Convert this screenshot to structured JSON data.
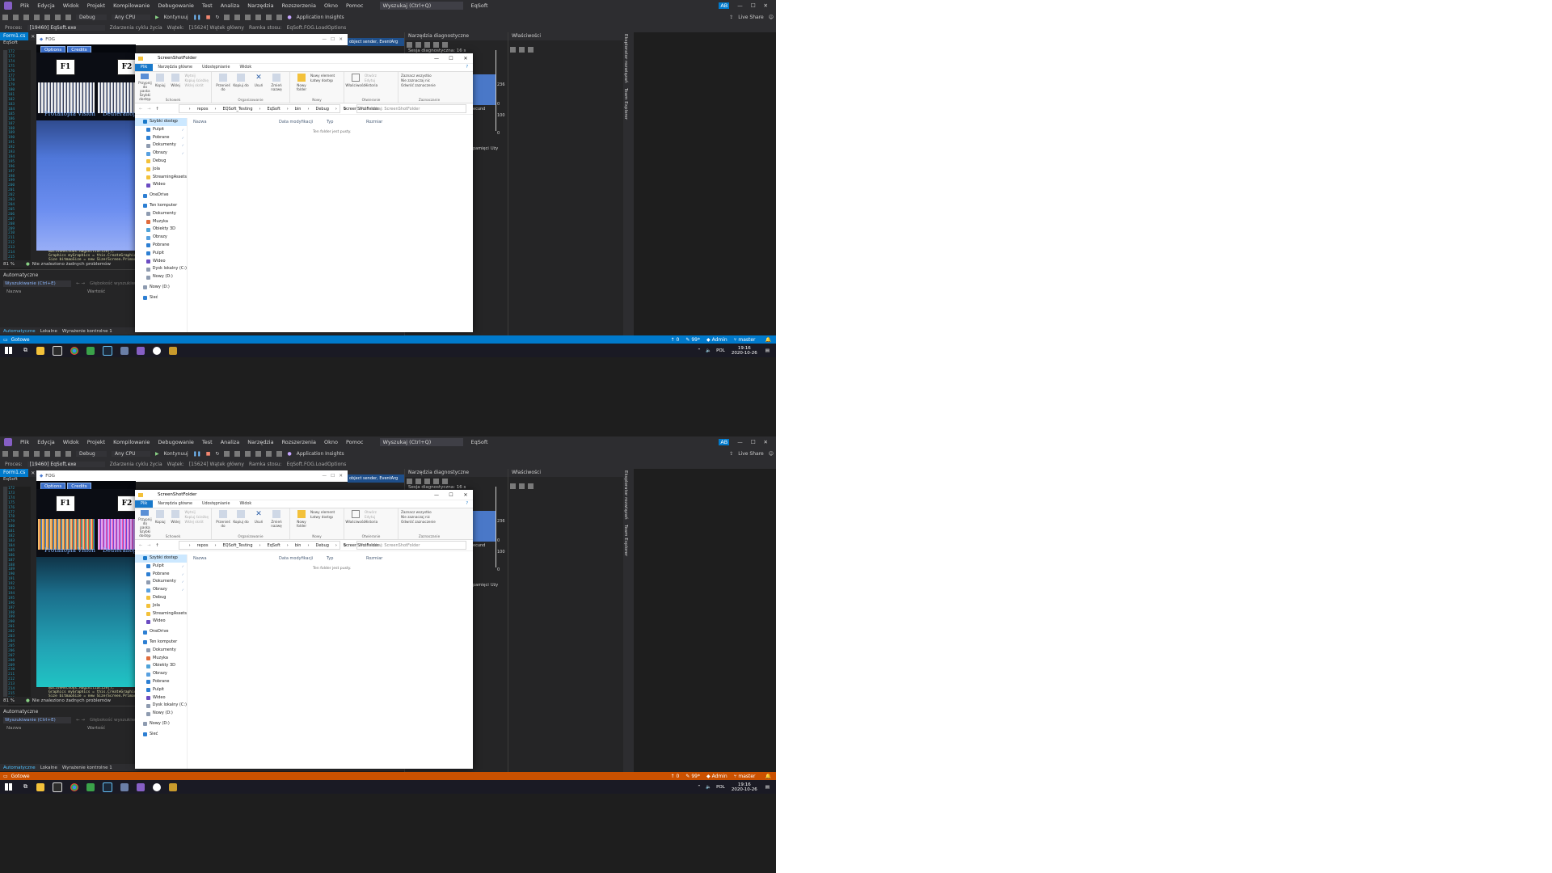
{
  "vs": {
    "menu": [
      "Plik",
      "Edycja",
      "Widok",
      "Projekt",
      "Kompilowanie",
      "Debugowanie",
      "Test",
      "Analiza",
      "Narzędzia",
      "Rozszerzenia",
      "Okno",
      "Pomoc"
    ],
    "search_placeholder": "Wyszukaj (Ctrl+Q)",
    "solution_name": "EqSoft",
    "user_initials": "AB",
    "toolbar": {
      "config": "Debug",
      "platform": "Any CPU",
      "continue_label": "Kontynuuj",
      "app_insights": "Application Insights",
      "live_share": "Live Share"
    },
    "process_bar": {
      "process_label": "Proces:",
      "process_value": "[19460] EqSoft.exe",
      "lifecycle": "Zdarzenia cyklu życia",
      "thread_label": "Wątek:",
      "thread_value": "[15624] Wątek główny",
      "stack_label": "Ramka stosu:",
      "stack_value": "EqSoft.FOG.LoadOptions"
    },
    "editor_tab": "Form1.cs",
    "editor_tab2": "EqSoft",
    "line_numbers": [
      "172",
      "173",
      "174",
      "175",
      "176",
      "177",
      "178",
      "179",
      "180",
      "181",
      "182",
      "183",
      "184",
      "185",
      "186",
      "187",
      "188",
      "189",
      "190",
      "191",
      "192",
      "193",
      "194",
      "195",
      "196",
      "197",
      "198",
      "199",
      "200",
      "201",
      "202",
      "203",
      "204",
      "205",
      "206",
      "207",
      "208",
      "209",
      "210",
      "211",
      "212",
      "213",
      "214",
      "215",
      "216",
      "217",
      "218",
      "219",
      "220",
      "221",
      "222",
      "223",
      "224"
    ],
    "code_lines": [
      "NativeMethods.MagInitialize();",
      "Graphics myGraphics = this.CreateGraphics();",
      "Size bitmapSize = new Size(Screen.PrimaryS"
    ],
    "zoom": "81 %",
    "no_issues": "Nie znaleziono żadnych problemów",
    "diag_title": "Narzędzia diagnostyczne",
    "diag_session": "Sesja diagnostyczna: 16 s",
    "diag_values": [
      "236",
      "0",
      "100",
      "0"
    ],
    "diag_dropdown": "object sender, EventArg",
    "diag_mem": "pamięci",
    "diag_use": "Uży",
    "diag_second": "ecund",
    "props_title": "Właściwości",
    "right_strip": [
      "Eksplorator rozwiązań",
      "Team Explorer"
    ],
    "auto_title": "Automatyczne",
    "auto_search": "Wyszukiwanie (Ctrl+E)",
    "auto_depth": "Głębokość wyszukiwania:",
    "auto_cols": [
      "Nazwa",
      "Wartość"
    ],
    "bottom_tabs": [
      "Automatyczne",
      "Lokalne",
      "Wyrażenie kontrolne 1"
    ],
    "status_ready": "Gotowe",
    "status_right": [
      "0",
      "99*",
      "Admin",
      "master"
    ],
    "fog_title": "FOG",
    "game_buttons": [
      "Options",
      "Credits"
    ],
    "fkeys": [
      "F1",
      "F2"
    ],
    "visions": [
      "Protanopia Vision",
      "Deuteranopia"
    ]
  },
  "explorer": {
    "title": "ScreenShotFolder",
    "ribbon_tabs": [
      "Plik",
      "Narzędzia główne",
      "Udostępnianie",
      "Widok"
    ],
    "groups": {
      "clipboard": {
        "name": "Schowek",
        "pin": "Przypnij do paska Szybki dostęp",
        "copy": "Kopiuj",
        "paste": "Wklej",
        "cut": "Wytnij",
        "copy_path": "Kopiuj ścieżkę",
        "paste_shortcut": "Wklej skrót"
      },
      "organize": {
        "name": "Organizowanie",
        "move": "Przenieś do",
        "copy_to": "Kopiuj do",
        "delete": "Usuń",
        "rename": "Zmień nazwę"
      },
      "new": {
        "name": "Nowy",
        "new_folder": "Nowy folder",
        "new_item": "Nowy element",
        "easy_access": "Łatwy dostęp"
      },
      "open": {
        "name": "Otwieranie",
        "properties": "Właściwości",
        "open": "Otwórz",
        "edit": "Edytuj",
        "history": "Historia"
      },
      "select": {
        "name": "Zaznaczanie",
        "all": "Zaznacz wszystko",
        "none": "Nie zaznaczaj nic",
        "invert": "Odwróć zaznaczenie"
      }
    },
    "path": [
      "repos",
      "EQSoft_Testing",
      "EqSoft",
      "bin",
      "Debug",
      "ScreenShotFolder"
    ],
    "search_placeholder": "Przeszukaj: ScreenShotFolder",
    "columns": [
      "Nazwa",
      "Data modyfikacji",
      "Typ",
      "Rozmiar"
    ],
    "empty_text": "Ten folder jest pusty.",
    "nav": [
      {
        "label": "Szybki dostęp",
        "kind": "star"
      },
      {
        "label": "Pulpit",
        "kind": "blue",
        "pin": true
      },
      {
        "label": "Pobrane",
        "kind": "down",
        "pin": true
      },
      {
        "label": "Dokumenty",
        "kind": "doc",
        "pin": true
      },
      {
        "label": "Obrazy",
        "kind": "img",
        "pin": true
      },
      {
        "label": "Debug",
        "kind": "folder"
      },
      {
        "label": "Jola",
        "kind": "folder"
      },
      {
        "label": "StreamingAssets",
        "kind": "folder"
      },
      {
        "label": "Wideo",
        "kind": "vid"
      },
      {
        "label": "",
        "kind": "gap"
      },
      {
        "label": "OneDrive",
        "kind": "cloud"
      },
      {
        "label": "",
        "kind": "gap"
      },
      {
        "label": "Ten komputer",
        "kind": "pc"
      },
      {
        "label": "Dokumenty",
        "kind": "doc"
      },
      {
        "label": "Muzyka",
        "kind": "music"
      },
      {
        "label": "Obiekty 3D",
        "kind": "obj"
      },
      {
        "label": "Obrazy",
        "kind": "img"
      },
      {
        "label": "Pobrane",
        "kind": "down"
      },
      {
        "label": "Pulpit",
        "kind": "blue"
      },
      {
        "label": "Wideo",
        "kind": "vid"
      },
      {
        "label": "Dysk lokalny (C:)",
        "kind": "drive"
      },
      {
        "label": "Nowy (D:)",
        "kind": "drive"
      },
      {
        "label": "",
        "kind": "gap"
      },
      {
        "label": "Nowy (D:)",
        "kind": "drive"
      },
      {
        "label": "",
        "kind": "gap"
      },
      {
        "label": "Sieć",
        "kind": "net"
      }
    ]
  },
  "taskbar": {
    "lang": "POL",
    "time": "19:16",
    "date": "2020-10-26"
  },
  "colors": {
    "vs_blue": "#007acc",
    "vs_purple": "#865fc5",
    "debug_orange": "#ca5100",
    "explorer_blue": "#1979ca"
  }
}
